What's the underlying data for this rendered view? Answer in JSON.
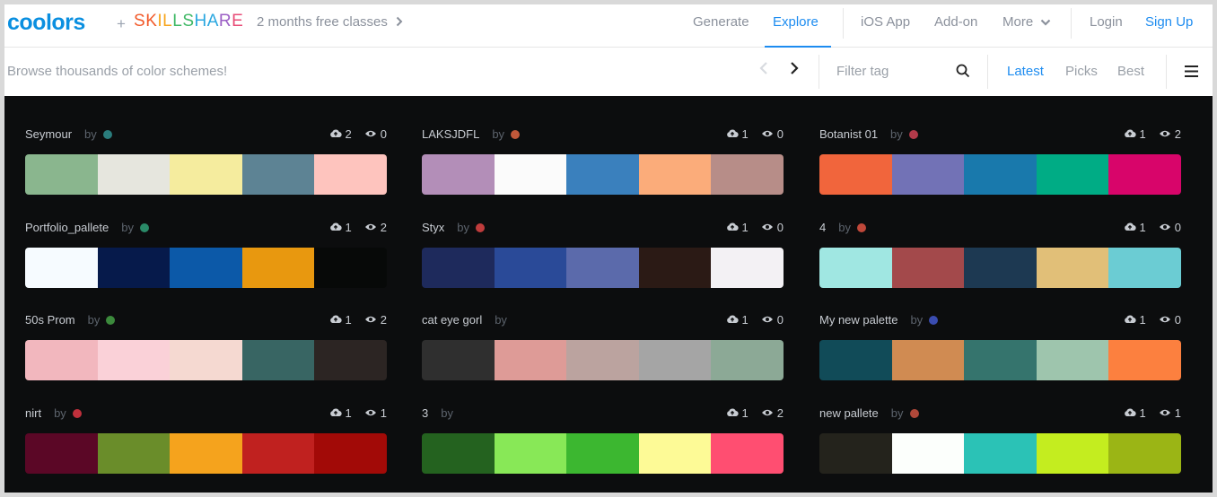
{
  "header": {
    "logo_text": "coolors",
    "plus": "+",
    "skillshare_letters": [
      "S",
      "K",
      "I",
      "L",
      "L",
      "S",
      "H",
      "A",
      "R",
      "E"
    ],
    "skillshare_colors": [
      "#f25a2a",
      "#f25a2a",
      "#f7a51d",
      "#f7a51d",
      "#3fb865",
      "#3fb865",
      "#2aa7e0",
      "#2aa7e0",
      "#9b5fc5",
      "#e84c77"
    ],
    "promo": "2 months free classes",
    "nav": [
      "Generate",
      "Explore",
      "iOS App",
      "Add-on",
      "More",
      "Login",
      "Sign Up"
    ]
  },
  "subbar": {
    "browse_placeholder": "Browse thousands of color schemes!",
    "filter_placeholder": "Filter tag",
    "sort": [
      "Latest",
      "Picks",
      "Best"
    ]
  },
  "palettes": [
    {
      "name": "Seymour",
      "by": "by",
      "avatar": "#2a7c7c",
      "saves": "2",
      "views": "0",
      "colors": [
        "#8ab68e",
        "#e6e6de",
        "#f5ec9e",
        "#5d8394",
        "#fec4be"
      ]
    },
    {
      "name": "LAKSJDFL",
      "by": "by",
      "avatar": "#c0583a",
      "saves": "1",
      "views": "0",
      "colors": [
        "#b38eb8",
        "#fbfbfb",
        "#3a80bd",
        "#fbac7a",
        "#b78d88"
      ]
    },
    {
      "name": "Botanist 01",
      "by": "by",
      "avatar": "#b33a4a",
      "saves": "1",
      "views": "2",
      "colors": [
        "#f1653c",
        "#7272b6",
        "#1979ac",
        "#00ac85",
        "#d8056a"
      ]
    },
    {
      "name": "Portfolio_pallete",
      "by": "by",
      "avatar": "#2a8a68",
      "saves": "1",
      "views": "2",
      "colors": [
        "#f6fbff",
        "#061a4b",
        "#0c59a8",
        "#e8980f",
        "#070908"
      ]
    },
    {
      "name": "Styx",
      "by": "by",
      "avatar": "#c03c3c",
      "saves": "1",
      "views": "0",
      "colors": [
        "#1e2a5c",
        "#2a4a98",
        "#5b6aab",
        "#2b1a15",
        "#f3f1f4"
      ]
    },
    {
      "name": "4",
      "by": "by",
      "avatar": "#c0483a",
      "saves": "1",
      "views": "0",
      "colors": [
        "#a0e7e2",
        "#a3494b",
        "#1d3952",
        "#e1bf78",
        "#6bccd3"
      ]
    },
    {
      "name": "50s Prom",
      "by": "by",
      "avatar": "#3c8a3c",
      "saves": "1",
      "views": "2",
      "colors": [
        "#f2b7be",
        "#fad1d8",
        "#f5d9d1",
        "#386563",
        "#2c2523"
      ]
    },
    {
      "name": "cat eye gorl",
      "by": "by",
      "avatar": "",
      "saves": "1",
      "views": "0",
      "colors": [
        "#2f2f2f",
        "#de9b97",
        "#bba39f",
        "#a5a5a5",
        "#8ca996"
      ]
    },
    {
      "name": "My new palette",
      "by": "by",
      "avatar": "#3a4cb0",
      "saves": "1",
      "views": "0",
      "colors": [
        "#114b58",
        "#d08b52",
        "#35746d",
        "#9ec5ad",
        "#fc803f"
      ]
    },
    {
      "name": "nirt",
      "by": "by",
      "avatar": "#c0303c",
      "saves": "1",
      "views": "1",
      "colors": [
        "#5b0726",
        "#6a8d2a",
        "#f5a31d",
        "#c0211f",
        "#a20a07"
      ]
    },
    {
      "name": "3",
      "by": "by",
      "avatar": "",
      "saves": "1",
      "views": "2",
      "colors": [
        "#24621f",
        "#88e857",
        "#3cb730",
        "#fdfa96",
        "#ff4e71"
      ]
    },
    {
      "name": "new pallete",
      "by": "by",
      "avatar": "#b0483a",
      "saves": "1",
      "views": "1",
      "colors": [
        "#24231c",
        "#fcfffc",
        "#2bc2b6",
        "#c4ed1f",
        "#9bb515"
      ]
    }
  ]
}
